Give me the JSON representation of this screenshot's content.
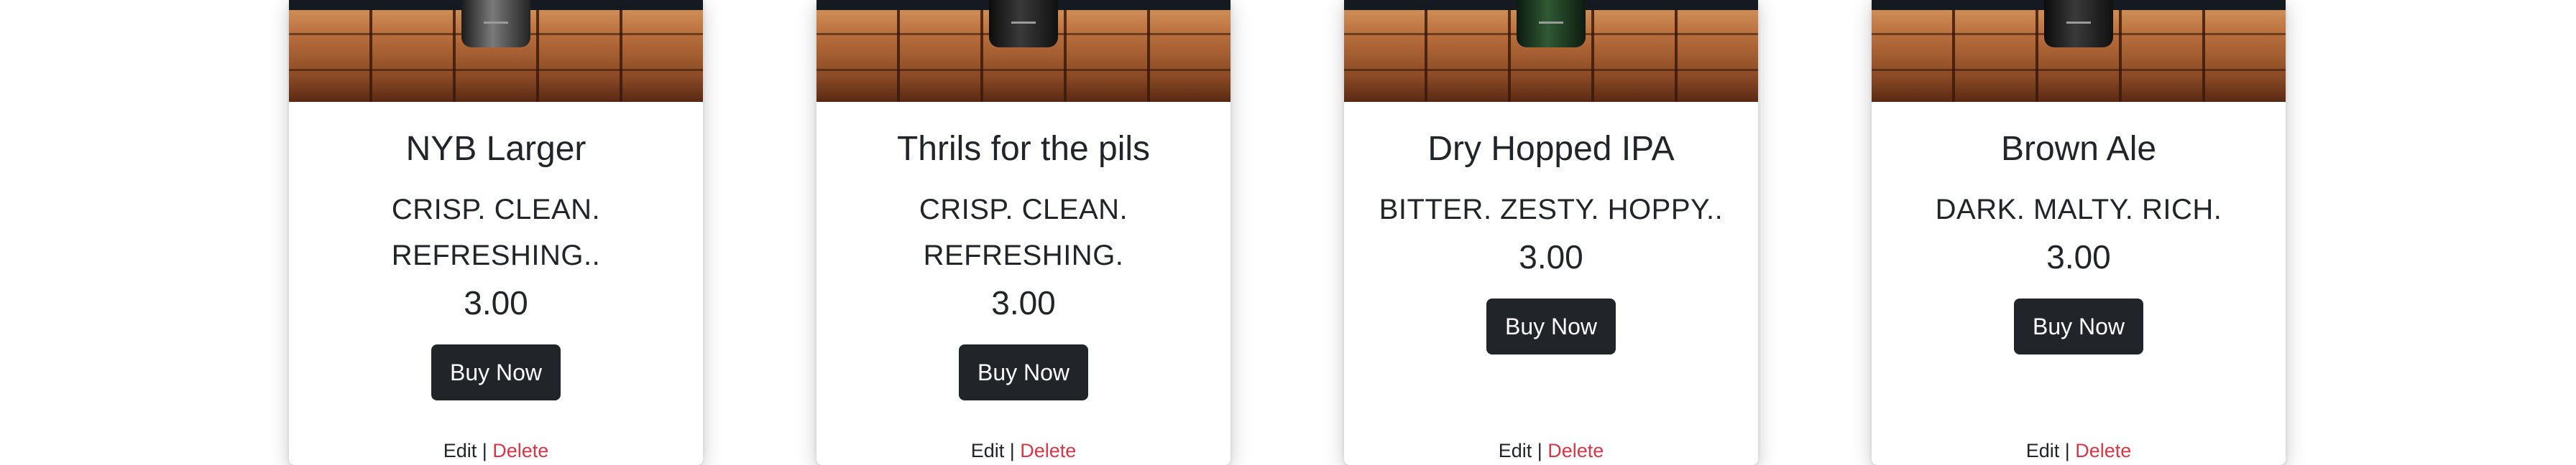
{
  "products": [
    {
      "title": "NYB Larger",
      "description": "CRISP.  CLEAN. REFRESHING..",
      "price": "3.00",
      "buy_label": "Buy Now",
      "edit_label": "Edit",
      "separator": "|",
      "delete_label": "Delete",
      "image_icon": "beer-can-photo"
    },
    {
      "title": "Thrils for the pils",
      "description": "CRISP.  CLEAN. REFRESHING.",
      "price": "3.00",
      "buy_label": "Buy Now",
      "edit_label": "Edit",
      "separator": "|",
      "delete_label": "Delete",
      "image_icon": "beer-can-photo"
    },
    {
      "title": "Dry Hopped IPA",
      "description": "BITTER.  ZESTY.  HOPPY..",
      "price": "3.00",
      "buy_label": "Buy Now",
      "edit_label": "Edit",
      "separator": "|",
      "delete_label": "Delete",
      "image_icon": "beer-can-photo"
    },
    {
      "title": "Brown Ale",
      "description": "DARK.  MALTY.  RICH.",
      "price": "3.00",
      "buy_label": "Buy Now",
      "edit_label": "Edit",
      "separator": "|",
      "delete_label": "Delete",
      "image_icon": "beer-can-photo"
    }
  ],
  "colors": {
    "button_bg": "#212529",
    "delete_link": "#dc3545",
    "text": "#212529"
  }
}
